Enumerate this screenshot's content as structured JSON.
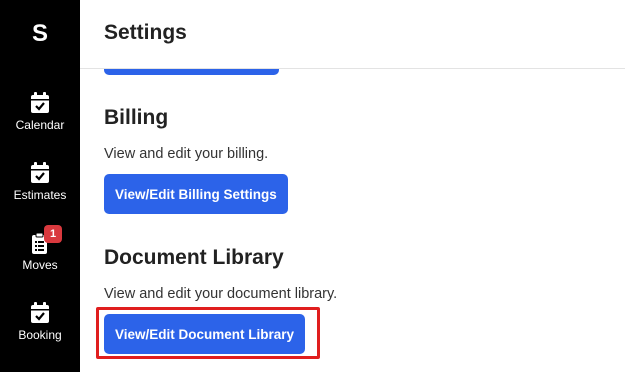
{
  "sidebar": {
    "logo": "S",
    "items": [
      {
        "label": "Calendar",
        "icon": "calendar-check-icon"
      },
      {
        "label": "Estimates",
        "icon": "calendar-check-icon"
      },
      {
        "label": "Moves",
        "icon": "clipboard-list-icon",
        "badge": "1"
      },
      {
        "label": "Booking",
        "icon": "calendar-check-icon"
      }
    ]
  },
  "header": {
    "title": "Settings"
  },
  "sections": [
    {
      "heading": "Billing",
      "description": "View and edit your billing.",
      "button": "View/Edit Billing Settings"
    },
    {
      "heading": "Document Library",
      "description": "View and edit your document library.",
      "button": "View/Edit Document Library"
    }
  ],
  "colors": {
    "sidebar_bg": "#000000",
    "primary_button": "#2c63e9",
    "badge": "#d9393e",
    "highlight_outline": "#e01e1e"
  }
}
